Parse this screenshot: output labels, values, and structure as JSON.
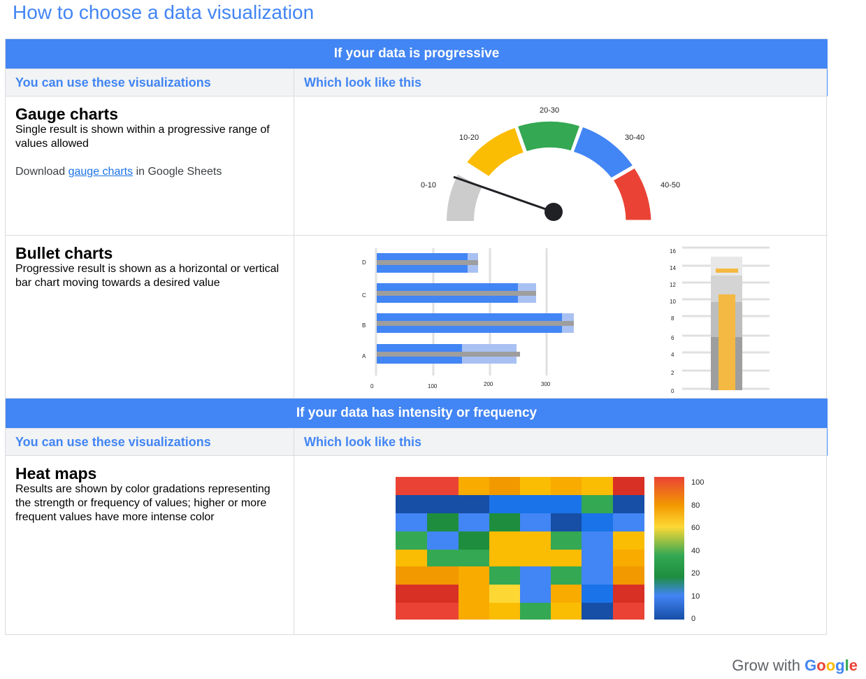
{
  "page_title": "How to choose a data visualization",
  "sections": [
    {
      "band": "If your data is progressive",
      "col_left": "You can use these visualizations",
      "col_right": "Which look like this"
    },
    {
      "band": "If your data has intensity or frequency",
      "col_left": "You can use these visualizations",
      "col_right": "Which look like this"
    }
  ],
  "gauge": {
    "title": "Gauge charts",
    "description": "Single result is shown within a progressive range of values allowed",
    "download_prefix": "Download ",
    "download_link": "gauge charts",
    "download_suffix": " in Google Sheets",
    "segments": [
      "0-10",
      "10-20",
      "20-30",
      "30-40",
      "40-50"
    ],
    "colors": {
      "gray": "#cccccc",
      "yellow": "#fbbc04",
      "green": "#34a853",
      "blue": "#4285f4",
      "red": "#ea4335"
    }
  },
  "bullet": {
    "title": "Bullet charts",
    "description": "Progressive result is shown as a horizontal or vertical bar chart moving towards a desired value",
    "h_categories": [
      "D",
      "C",
      "B",
      "A"
    ],
    "h_ticks": [
      "0",
      "100",
      "200",
      "300"
    ],
    "v_ticks": [
      "16",
      "14",
      "12",
      "10",
      "8",
      "6",
      "4",
      "2",
      "0"
    ]
  },
  "heatmap": {
    "title": "Heat maps",
    "description": "Results are shown by color gradations representing the strength or frequency of values; higher or more frequent values have more intense color",
    "scale_labels": [
      "100",
      "80",
      "60",
      "40",
      "20",
      "10",
      "0"
    ]
  },
  "brand": {
    "prefix": "Grow with ",
    "name": "Google"
  }
}
